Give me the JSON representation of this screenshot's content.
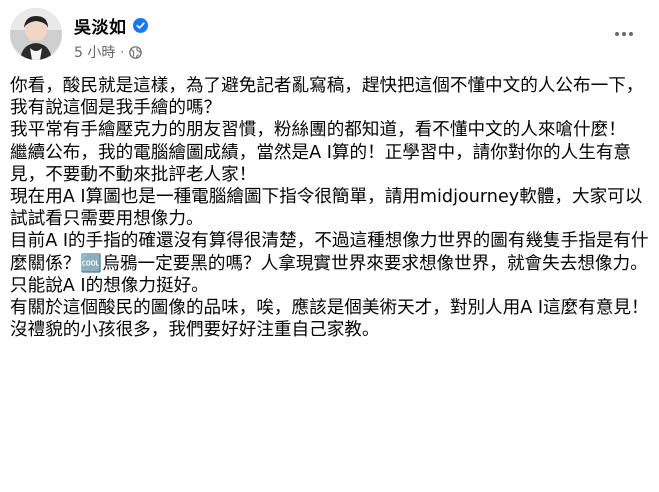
{
  "post": {
    "author": "吳淡如",
    "time": "5 小時",
    "separator": "·",
    "paragraphs": [
      "你看，酸民就是這樣，為了避免記者亂寫稿，趕快把這個不懂中文的人公布一下，我有說這個是我手繪的嗎？",
      "我平常有手繪壓克力的朋友習慣，粉絲團的都知道，看不懂中文的人來嗆什麼！",
      "繼續公布，我的電腦繪圖成績，當然是A I算的！正學習中，請你對你的人生有意見，不要動不動來批評老人家！",
      "現在用A I算圖也是一種電腦繪圖下指令很簡單，請用midjourney軟體，大家可以試試看只需要用想像力。",
      "目前A I的手指的確還沒有算得很清楚，不過這種想像力世界的圖有幾隻手指是有什麼關係？🆒烏鴉一定要黑的嗎？人拿現實世界來要求想像世界，就會失去想像力。",
      "只能說A I的想像力挺好。",
      "有關於這個酸民的圖像的品味，唉，應該是個美術天才，對別人用A I這麼有意見！",
      "沒禮貌的小孩很多，我們要好好注重自己家教。"
    ]
  },
  "icons": {
    "verified": "verified-badge-icon",
    "globe": "globe-icon",
    "more": "more-options-icon"
  },
  "colors": {
    "text": "#050505",
    "meta": "#65676b",
    "verified": "#1877f2"
  }
}
